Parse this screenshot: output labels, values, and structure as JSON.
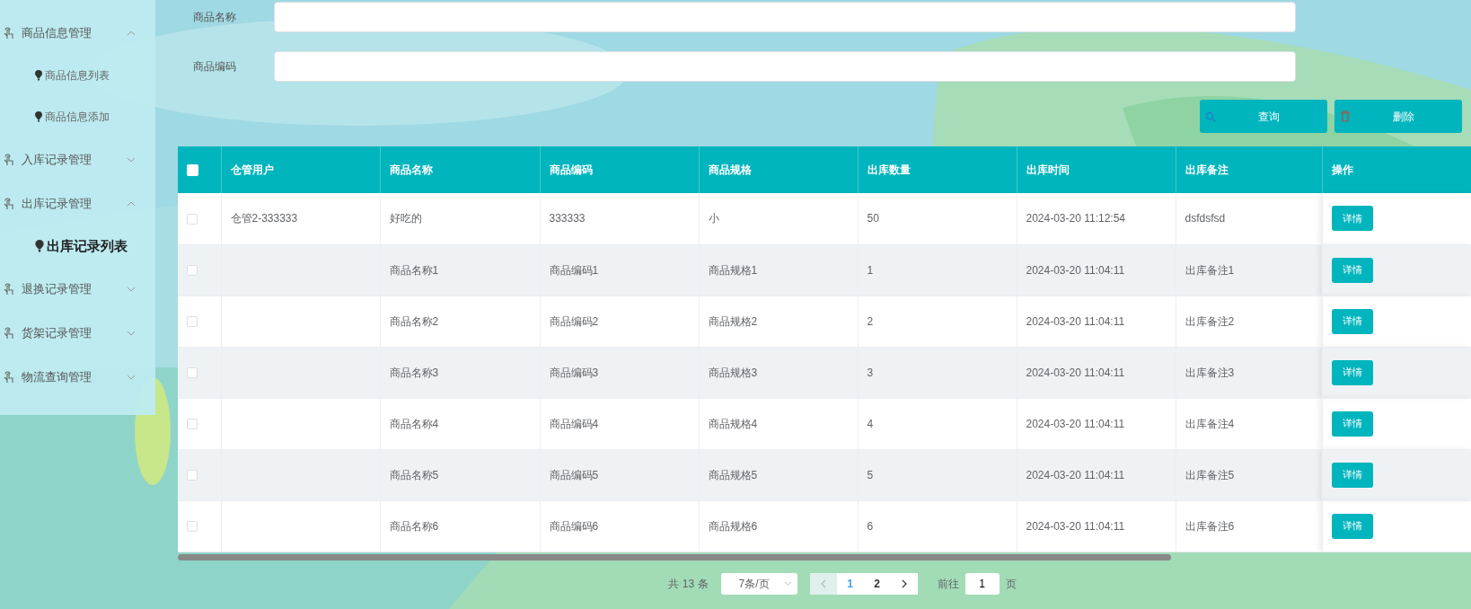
{
  "sidebar": {
    "groups": [
      {
        "label": "商品信息管理",
        "expanded": true,
        "children": [
          {
            "label": "商品信息列表",
            "selected": false
          },
          {
            "label": "商品信息添加",
            "selected": false
          }
        ]
      },
      {
        "label": "入库记录管理",
        "expanded": false
      },
      {
        "label": "出库记录管理",
        "expanded": true,
        "children": [
          {
            "label": "出库记录列表",
            "selected": true
          }
        ]
      },
      {
        "label": "退换记录管理",
        "expanded": false
      },
      {
        "label": "货架记录管理",
        "expanded": false
      },
      {
        "label": "物流查询管理",
        "expanded": false
      }
    ]
  },
  "search": {
    "fields": [
      {
        "label": "商品名称"
      },
      {
        "label": "商品编码"
      }
    ]
  },
  "buttons": [
    {
      "label": "查询",
      "kind": "search"
    },
    {
      "label": "删除",
      "kind": "delete"
    }
  ],
  "table": {
    "header_checked": false,
    "columns": [
      "仓管用户",
      "商品名称",
      "商品编码",
      "商品规格",
      "出库数量",
      "出库时间",
      "出库备注",
      "操作"
    ],
    "rows": [
      {
        "checked": false,
        "cells": [
          "仓管2-333333",
          "好吃的",
          "333333",
          "小",
          "50",
          "2024-03-20 11:12:54",
          "dsfdsfsd"
        ],
        "action": "详情"
      },
      {
        "checked": false,
        "cells": [
          "",
          "商品名称1",
          "商品编码1",
          "商品规格1",
          "1",
          "2024-03-20 11:04:11",
          "出库备注1"
        ],
        "action": "详情"
      },
      {
        "checked": false,
        "cells": [
          "",
          "商品名称2",
          "商品编码2",
          "商品规格2",
          "2",
          "2024-03-20 11:04:11",
          "出库备注2"
        ],
        "action": "详情"
      },
      {
        "checked": false,
        "cells": [
          "",
          "商品名称3",
          "商品编码3",
          "商品规格3",
          "3",
          "2024-03-20 11:04:11",
          "出库备注3"
        ],
        "action": "详情"
      },
      {
        "checked": false,
        "cells": [
          "",
          "商品名称4",
          "商品编码4",
          "商品规格4",
          "4",
          "2024-03-20 11:04:11",
          "出库备注4"
        ],
        "action": "详情"
      },
      {
        "checked": false,
        "cells": [
          "",
          "商品名称5",
          "商品编码5",
          "商品规格5",
          "5",
          "2024-03-20 11:04:11",
          "出库备注5"
        ],
        "action": "详情"
      },
      {
        "checked": false,
        "cells": [
          "",
          "商品名称6",
          "商品编码6",
          "商品规格6",
          "6",
          "2024-03-20 11:04:11",
          "出库备注6"
        ],
        "action": "详情"
      }
    ]
  },
  "pagination": {
    "total": "共 13 条",
    "page_size": "7条/页",
    "pages": [
      {
        "label": "1",
        "selected": true
      },
      {
        "label": "2",
        "selected": false
      }
    ],
    "goto_label": "前往",
    "goto_value": "1",
    "goto_suffix": "页"
  }
}
